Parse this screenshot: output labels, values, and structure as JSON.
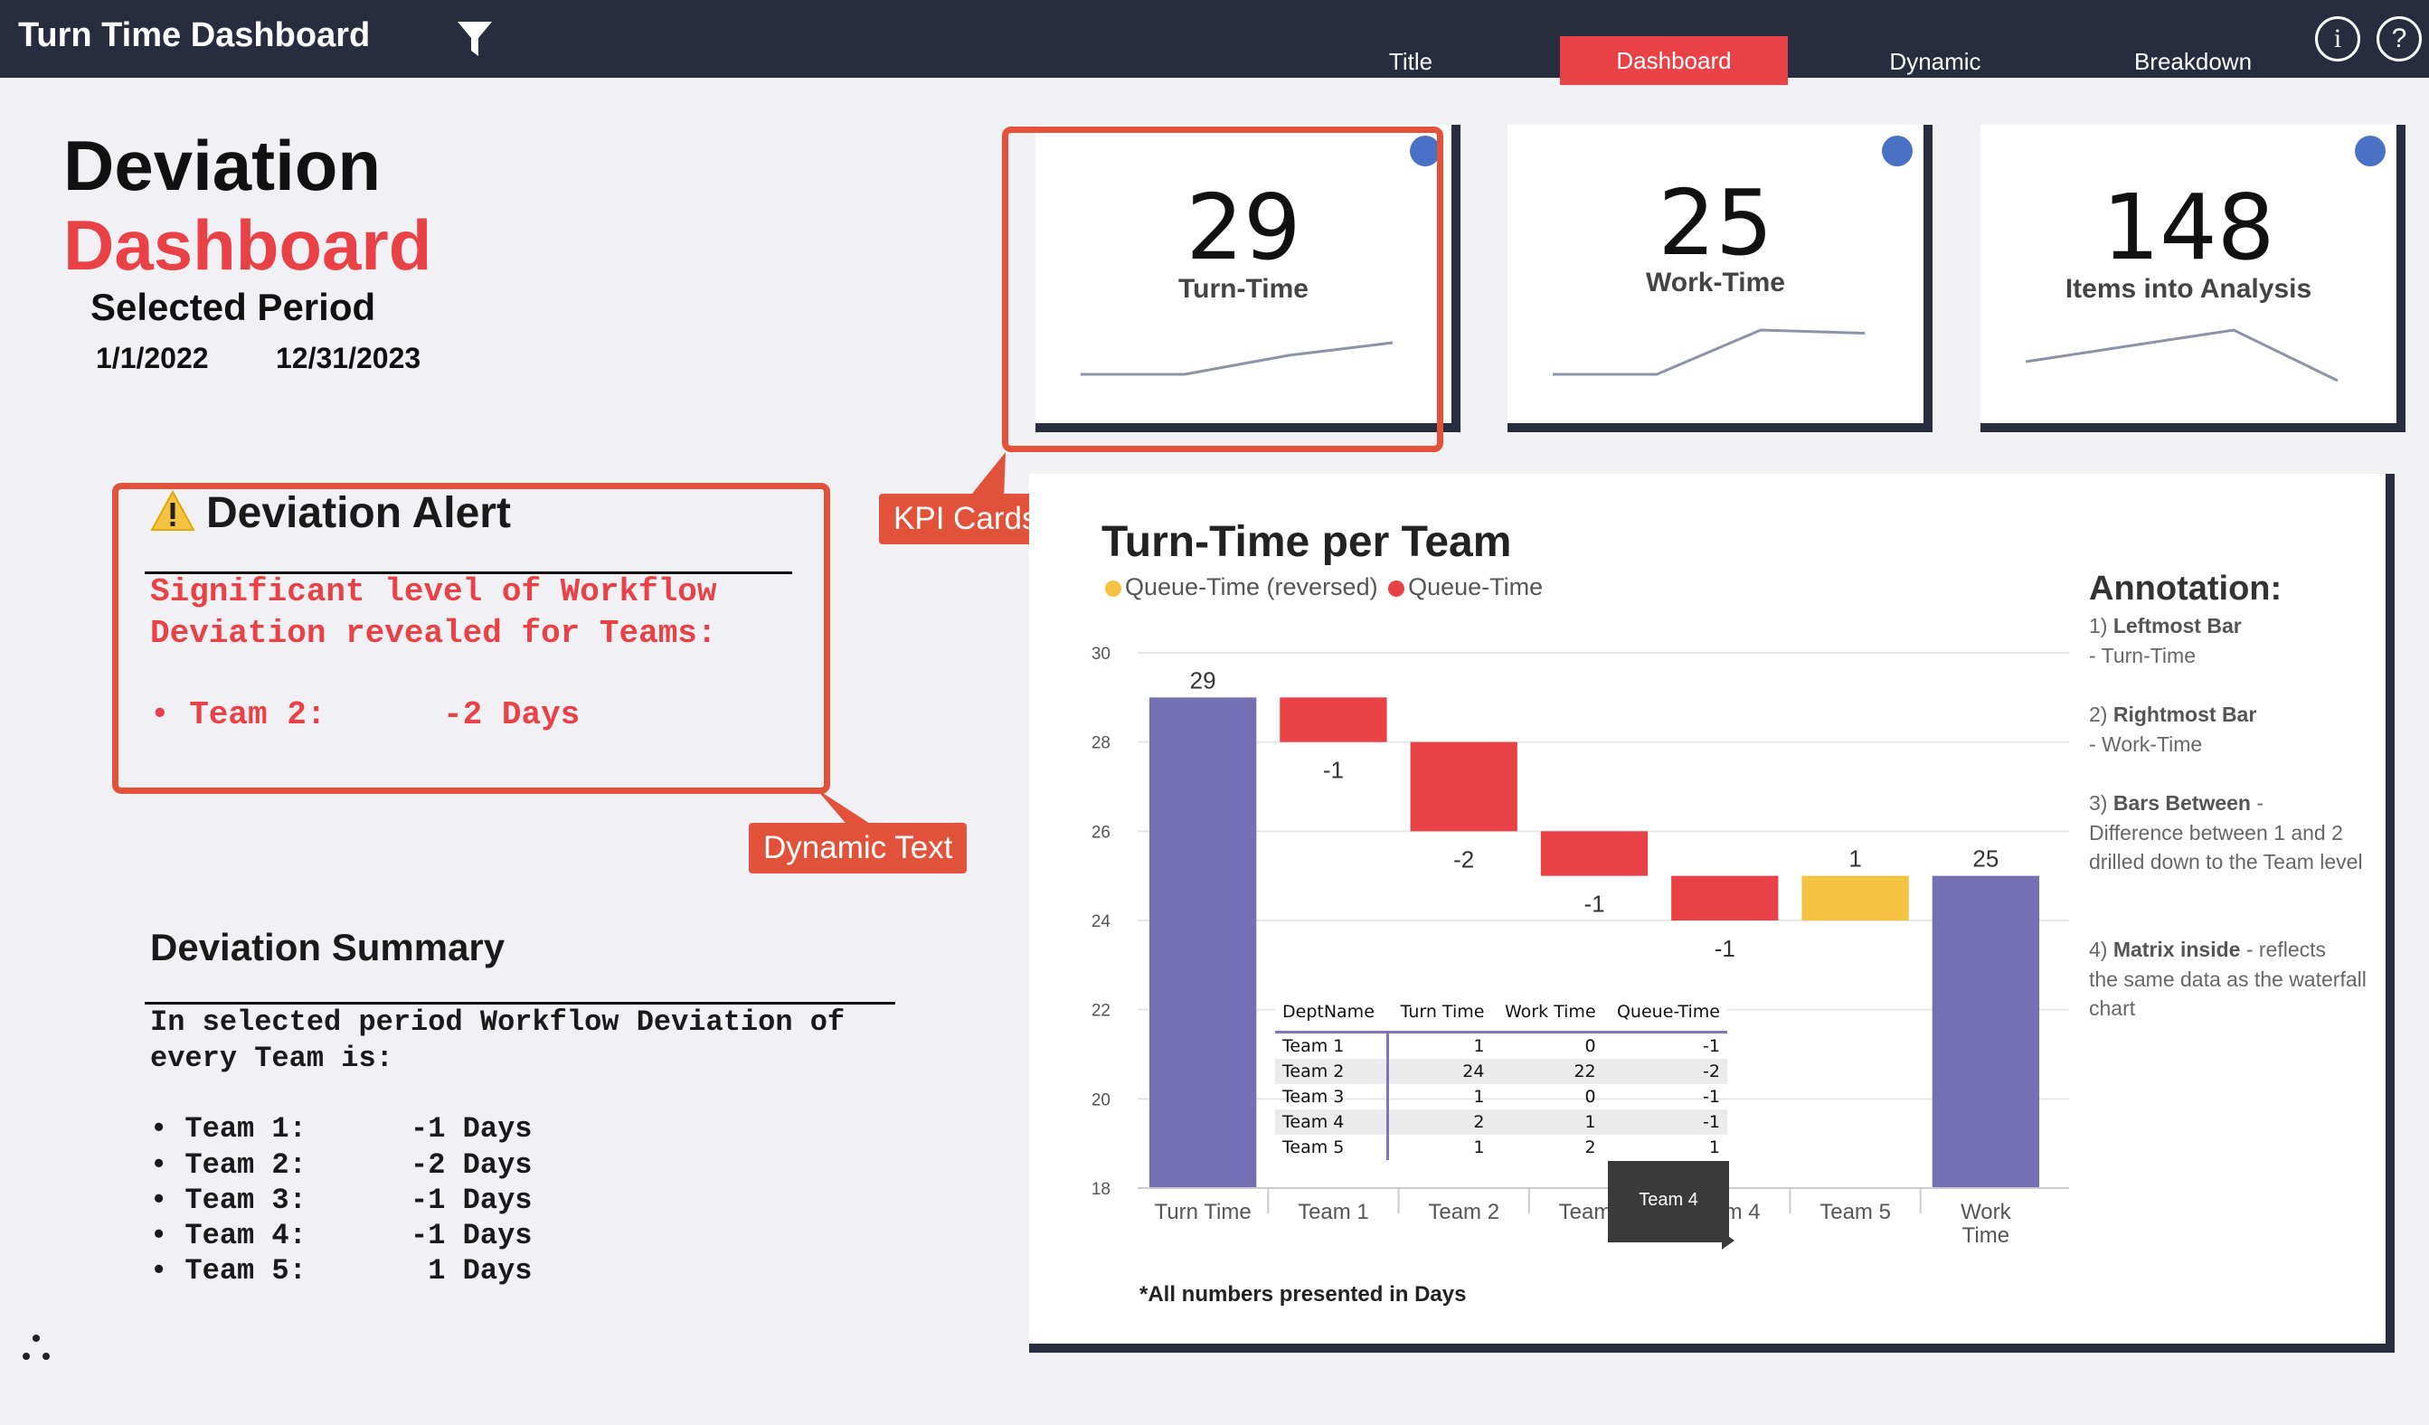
{
  "app": {
    "title": "Turn Time Dashboard"
  },
  "nav": {
    "tabs": [
      "Title",
      "Dashboard",
      "Dynamic",
      "Breakdown"
    ],
    "active": "Dashboard"
  },
  "icons": {
    "filter": "filter-icon",
    "info": "info-icon",
    "help": "help-icon",
    "warning": "warning-icon",
    "menu": "dots-icon"
  },
  "colors": {
    "accent": "#e84246",
    "topbar": "#272d3f",
    "bar_total": "#7570b3",
    "bar_negative": "#e84246",
    "bar_positive": "#f4c342",
    "kpi_dot": "#4a72c4"
  },
  "header": {
    "title_line1": "Deviation",
    "title_line2": "Dashboard",
    "period_label": "Selected Period",
    "period_start": "1/1/2022",
    "period_end": "12/31/2023"
  },
  "kpis": [
    {
      "value": "29",
      "label": "Turn-Time",
      "trend": [
        0.2,
        0.2,
        0.5,
        0.7
      ]
    },
    {
      "value": "25",
      "label": "Work-Time",
      "trend": [
        0.2,
        0.2,
        0.9,
        0.85
      ]
    },
    {
      "value": "148",
      "label": "Items into Analysis",
      "trend": [
        0.4,
        0.65,
        0.9,
        0.1
      ]
    }
  ],
  "callouts": {
    "kpi": "KPI Cards",
    "dynamic": "Dynamic Text"
  },
  "alert": {
    "title": "Deviation Alert",
    "line1": "Significant level of Workflow",
    "line2": "Deviation revealed for Teams:",
    "bullet": "• Team 2:      -2 Days"
  },
  "summary": {
    "title": "Deviation Summary",
    "line1": "In selected period Workflow Deviation of",
    "line2": "every Team is:",
    "items": [
      "• Team 1:      -1 Days",
      "• Team 2:      -2 Days",
      "• Team 3:      -1 Days",
      "• Team 4:      -1 Days",
      "• Team 5:       1 Days"
    ]
  },
  "chart": {
    "title": "Turn-Time per Team",
    "legend": [
      "Queue-Time (reversed)",
      "Queue-Time"
    ],
    "footnote": "*All numbers presented in Days"
  },
  "chart_data": {
    "type": "bar",
    "subtype": "waterfall",
    "title": "Turn-Time per Team",
    "categories": [
      "Turn Time",
      "Team 1",
      "Team 2",
      "Team 3",
      "Team 4",
      "Team 5",
      "Work Time"
    ],
    "values": [
      29,
      -1,
      -2,
      -1,
      -1,
      1,
      25
    ],
    "kinds": [
      "total",
      "delta",
      "delta",
      "delta",
      "delta",
      "delta",
      "total"
    ],
    "data_labels": [
      "29",
      "-1",
      "-2",
      "-1",
      "-1",
      "1",
      "25"
    ],
    "ylim": [
      18,
      30
    ],
    "yticks": [
      18,
      20,
      22,
      24,
      26,
      28,
      30
    ],
    "series": [
      {
        "name": "Queue-Time (reversed)",
        "color": "#f4c342"
      },
      {
        "name": "Queue-Time",
        "color": "#e84246"
      }
    ],
    "grid": true,
    "legend_position": "top-left"
  },
  "annotation": {
    "title": "Annotation:",
    "items": [
      {
        "num": "1)",
        "bold": "Leftmost Bar",
        "rest": "",
        "line2": "- Turn-Time"
      },
      {
        "num": "2)",
        "bold": "Rightmost Bar",
        "rest": "",
        "line2": "- Work-Time"
      },
      {
        "num": "3)",
        "bold": "Bars Between",
        "rest": " -",
        "line2": "Difference between 1 and 2 drilled down to the Team level"
      },
      {
        "num": "4)",
        "bold": "Matrix inside",
        "rest": " - reflects",
        "line2": "the same data as the waterfall chart"
      }
    ]
  },
  "matrix": {
    "headers": [
      "DeptName",
      "Turn Time",
      "Work Time",
      "Queue-Time"
    ],
    "rows": [
      [
        "Team 1",
        "1",
        "0",
        "-1"
      ],
      [
        "Team 2",
        "24",
        "22",
        "-2"
      ],
      [
        "Team 3",
        "1",
        "0",
        "-1"
      ],
      [
        "Team 4",
        "2",
        "1",
        "-1"
      ],
      [
        "Team 5",
        "1",
        "2",
        "1"
      ]
    ]
  },
  "tooltip": {
    "text": "Team 4"
  }
}
